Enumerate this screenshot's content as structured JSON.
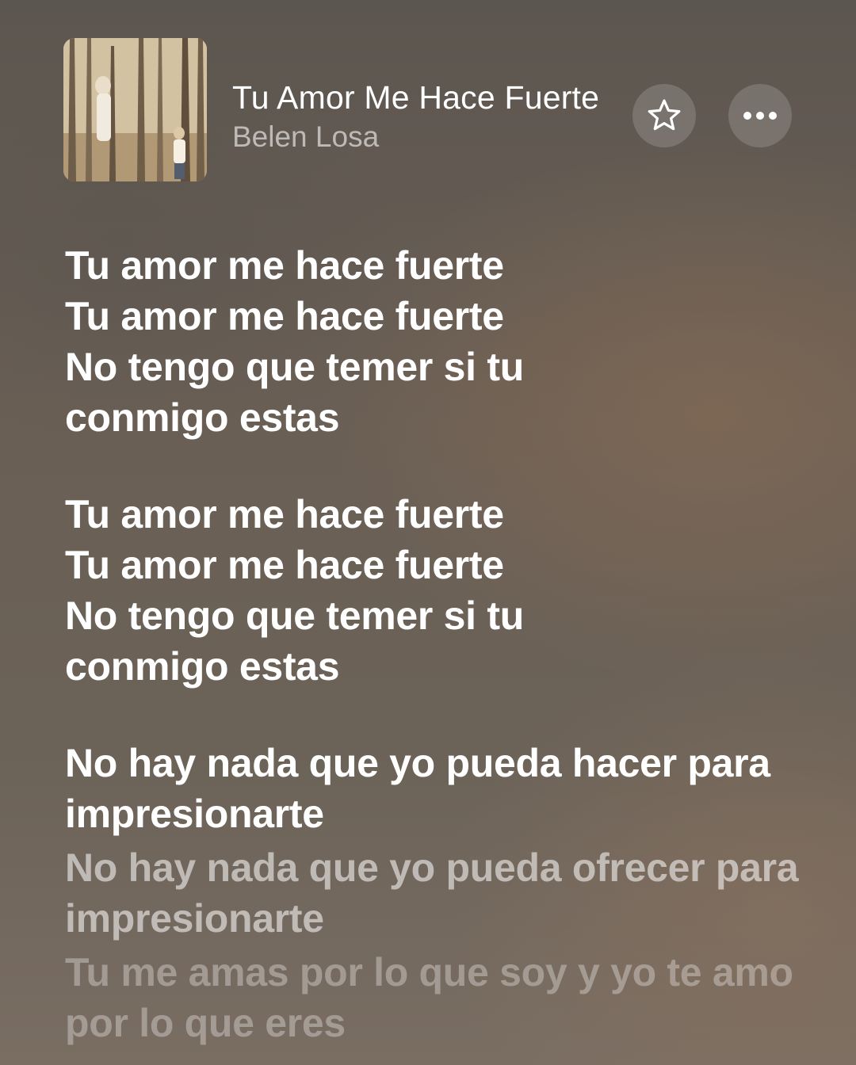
{
  "now_playing": {
    "title": "Tu Amor Me Hace Fuerte",
    "artist": "Belen Losa",
    "favorite_icon": "star-outline-icon",
    "more_icon": "ellipsis-icon"
  },
  "lyrics": [
    "Tu amor me hace fuerte",
    "Tu amor me hace fuerte",
    "No tengo que temer si tu conmigo estas",
    "Tu amor me hace fuerte",
    "Tu amor me hace fuerte",
    "No tengo que temer si tu conmigo estas",
    "No hay nada que yo pueda hacer para impresionarte",
    "No hay nada que yo pueda ofrecer para impresionarte",
    "Tu me amas por lo que soy y yo te amo por lo que eres"
  ]
}
